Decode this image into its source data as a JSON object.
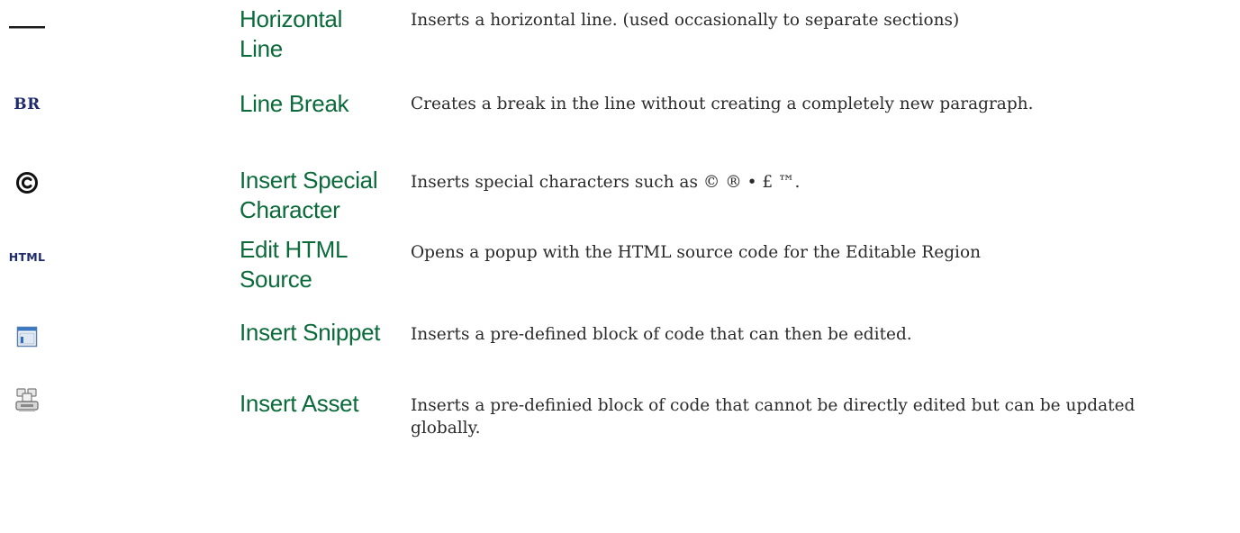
{
  "rows": [
    {
      "icon": "horizontal-line-icon",
      "name": "Horizontal Line",
      "description": "Inserts a horizontal line. (used occasionally to separate sections)"
    },
    {
      "icon": "line-break-icon",
      "icon_text": "BR",
      "name": "Line Break",
      "description": "Creates a break in the line without creating a completely new paragraph."
    },
    {
      "icon": "copyright-icon",
      "name": "Insert Special Character",
      "description": "Inserts special characters such as © ® • £ ™."
    },
    {
      "icon": "html-source-icon",
      "icon_text": "HTML",
      "name": "Edit HTML Source",
      "description": "Opens a popup with the HTML source code for the Editable Region"
    },
    {
      "icon": "snippet-icon",
      "name": "Insert Snippet",
      "description": "Inserts a pre-defined block of code that can then be edited."
    },
    {
      "icon": "asset-icon",
      "name": "Insert Asset",
      "description": "Inserts a pre-definied block of code that cannot be directly edited but can be updated globally."
    }
  ],
  "colors": {
    "name_text": "#0b6a3a",
    "description_text": "#2b2b2b",
    "icon_text": "#1e2a6e"
  }
}
